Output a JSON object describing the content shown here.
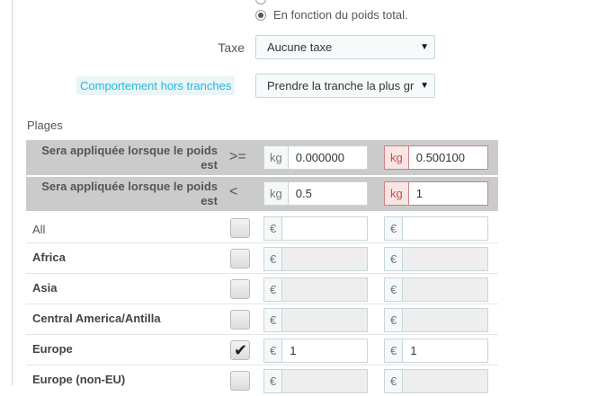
{
  "calc_method": {
    "options": [
      {
        "label": "",
        "checked": false
      },
      {
        "label": "En fonction du poids total.",
        "checked": true
      }
    ]
  },
  "tax": {
    "label": "Taxe",
    "selected": "Aucune taxe"
  },
  "out_of_range": {
    "label": "Comportement hors tranches",
    "selected": "Prendre la tranche la plus gr"
  },
  "ranges": {
    "title": "Plages",
    "lower_row": {
      "label": "Sera appliquée lorsque le poids est",
      "operator": ">=",
      "unit": "kg",
      "values": [
        "0.000000",
        "0.500100"
      ]
    },
    "upper_row": {
      "label": "Sera appliquée lorsque le poids est",
      "operator": "<",
      "unit": "kg",
      "values": [
        "0.5",
        "1"
      ]
    },
    "currency": "€",
    "zones": [
      {
        "name": "All",
        "checked": false,
        "prices": [
          "",
          ""
        ],
        "bold": false,
        "enabled": true
      },
      {
        "name": "Africa",
        "checked": false,
        "prices": [
          "",
          ""
        ],
        "bold": true,
        "enabled": false
      },
      {
        "name": "Asia",
        "checked": false,
        "prices": [
          "",
          ""
        ],
        "bold": true,
        "enabled": false
      },
      {
        "name": "Central America/Antilla",
        "checked": false,
        "prices": [
          "",
          ""
        ],
        "bold": true,
        "enabled": false
      },
      {
        "name": "Europe",
        "checked": true,
        "prices": [
          "1",
          "1"
        ],
        "bold": true,
        "enabled": true
      },
      {
        "name": "Europe (non-EU)",
        "checked": false,
        "prices": [
          "",
          ""
        ],
        "bold": true,
        "enabled": false
      }
    ]
  },
  "colors": {
    "header_row_bg": "#cbcbcb",
    "error_border": "#d08080",
    "help_label_text": "#25b9d7"
  }
}
